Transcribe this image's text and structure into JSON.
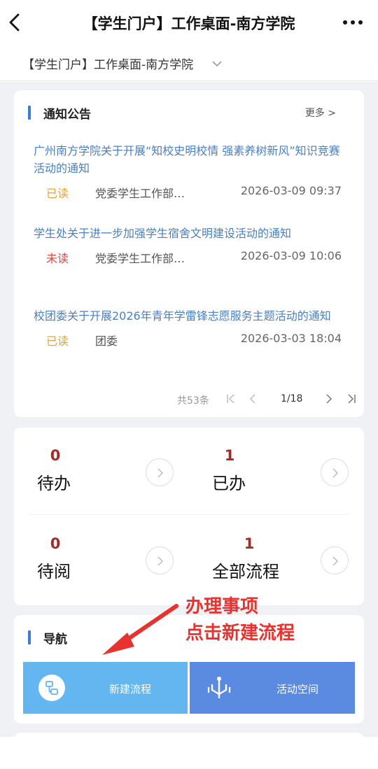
{
  "header": {
    "title": "【学生门户】工作桌面-南方学院",
    "back_icon": "chevron-left-icon",
    "more_icon": "more-dots-icon"
  },
  "portal_selector": {
    "label": "【学生门户】工作桌面-南方学院",
    "icon": "chevron-down-icon"
  },
  "notices": {
    "section_title": "通知公告",
    "more_label": "更多 >",
    "items": [
      {
        "title": "广州南方学院关于开展“知校史明校情 强素养树新风”知识竞赛活动的通知",
        "status": "已读",
        "dept": "党委学生工作部…",
        "time": "2026-03-09 09:37"
      },
      {
        "title": "学生处关于进一步加强学生宿舍文明建设活动的通知",
        "status": "未读",
        "dept": "党委学生工作部…",
        "time": "2026-03-09 10:06"
      },
      {
        "title": "校团委关于开展2026年青年学雷锋志愿服务主题活动的通知",
        "status": "已读",
        "dept": "团委",
        "time": "2026-03-03 18:04"
      }
    ],
    "pager": {
      "total": "共53条",
      "page": "1/18"
    }
  },
  "stats": [
    {
      "count": "0",
      "label": "待办"
    },
    {
      "count": "1",
      "label": "已办"
    },
    {
      "count": "0",
      "label": "待阅"
    },
    {
      "count": "1",
      "label": "全部流程"
    }
  ],
  "nav": {
    "section_title": "导航",
    "tiles": [
      {
        "label": "新建流程",
        "icon": "flowchart-icon"
      },
      {
        "label": "活动空间",
        "icon": "branch-icon"
      }
    ]
  },
  "annotation": {
    "line1": "办理事项",
    "line2": "点击新建流程"
  },
  "colors": {
    "accent": "#3a7bd5",
    "link": "#4a7fc1",
    "read": "#e8a33c",
    "unread": "#e0453a",
    "count": "#a52a24",
    "tile_new": "#63b6f0",
    "tile_activity": "#5b8be0",
    "annotation": "#e8322f"
  }
}
